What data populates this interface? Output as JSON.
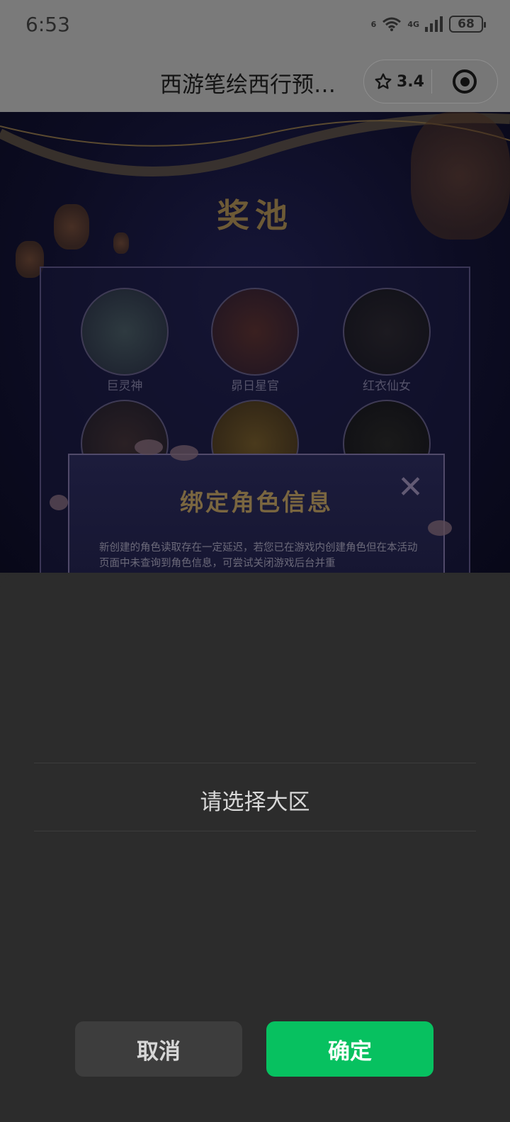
{
  "status_bar": {
    "time": "6:53",
    "battery": "68",
    "network_tag_1": "6",
    "network_tag_2": "4G"
  },
  "title_bar": {
    "title": "西游笔绘西行预…",
    "rating": "3.4"
  },
  "background": {
    "pool_title": "奖池",
    "heroes": [
      "巨灵神",
      "昴日星官",
      "红衣仙女"
    ],
    "bind_dialog": {
      "title": "绑定角色信息",
      "close": "✕",
      "description": "新创建的角色读取存在一定延迟，若您已在游戏内创建角色但在本活动页面中未查询到角色信息，可尝试关闭游戏后台并重"
    }
  },
  "sheet": {
    "picker_value": "请选择大区",
    "cancel_label": "取消",
    "confirm_label": "确定"
  },
  "colors": {
    "confirm": "#07c160",
    "sheet_bg": "#2c2c2c"
  }
}
